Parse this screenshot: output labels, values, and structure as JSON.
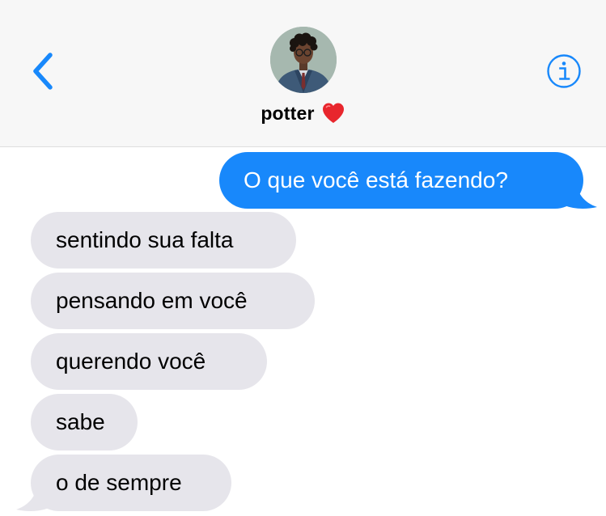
{
  "header": {
    "contact_name": "potter",
    "contact_emoji_icon": "red-heart-icon",
    "back_icon": "chevron-left-icon",
    "info_icon": "info-icon",
    "accent_color": "#1888fb"
  },
  "messages": [
    {
      "direction": "sent",
      "text": "O que você está fazendo?"
    },
    {
      "direction": "received",
      "text": "sentindo sua falta"
    },
    {
      "direction": "received",
      "text": "pensando em você"
    },
    {
      "direction": "received",
      "text": "querendo você"
    },
    {
      "direction": "received",
      "text": "sabe"
    },
    {
      "direction": "received",
      "text": "o de sempre"
    }
  ],
  "colors": {
    "sent_bubble": "#1888fb",
    "received_bubble": "#e6e5eb",
    "header_background": "#f7f7f7"
  }
}
